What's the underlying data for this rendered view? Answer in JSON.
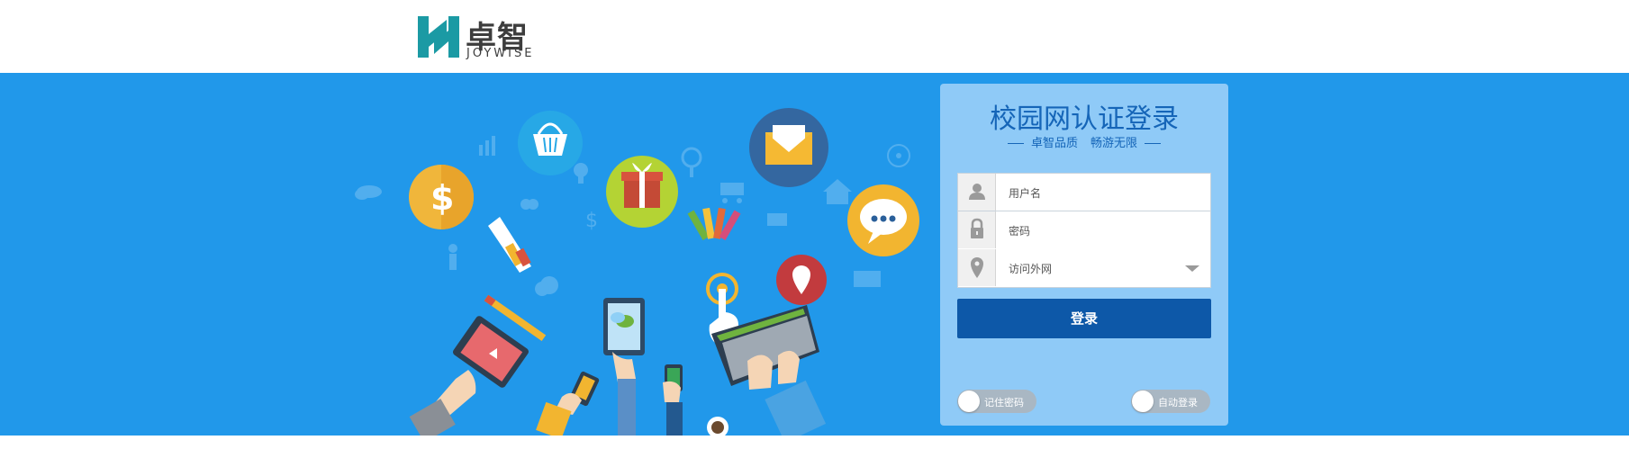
{
  "header": {
    "logo_cn": "卓智",
    "logo_en": "JOYWISE"
  },
  "login": {
    "title": "校园网认证登录",
    "subtitle_left": "卓智品质",
    "subtitle_right": "畅游无限",
    "username_placeholder": "用户名",
    "password_placeholder": "密码",
    "network_selected": "访问外网",
    "login_button": "登录",
    "remember_password": "记住密码",
    "auto_login": "自动登录"
  },
  "colors": {
    "banner_bg": "#2198ea",
    "panel_bg": "#8fcaf7",
    "button_bg": "#0d58a8",
    "title_color": "#1565b8",
    "logo_teal": "#1b9aa4"
  },
  "icons": {
    "username": "user-icon",
    "password": "lock-icon",
    "network": "location-pin-icon",
    "dropdown": "chevron-down-icon"
  }
}
